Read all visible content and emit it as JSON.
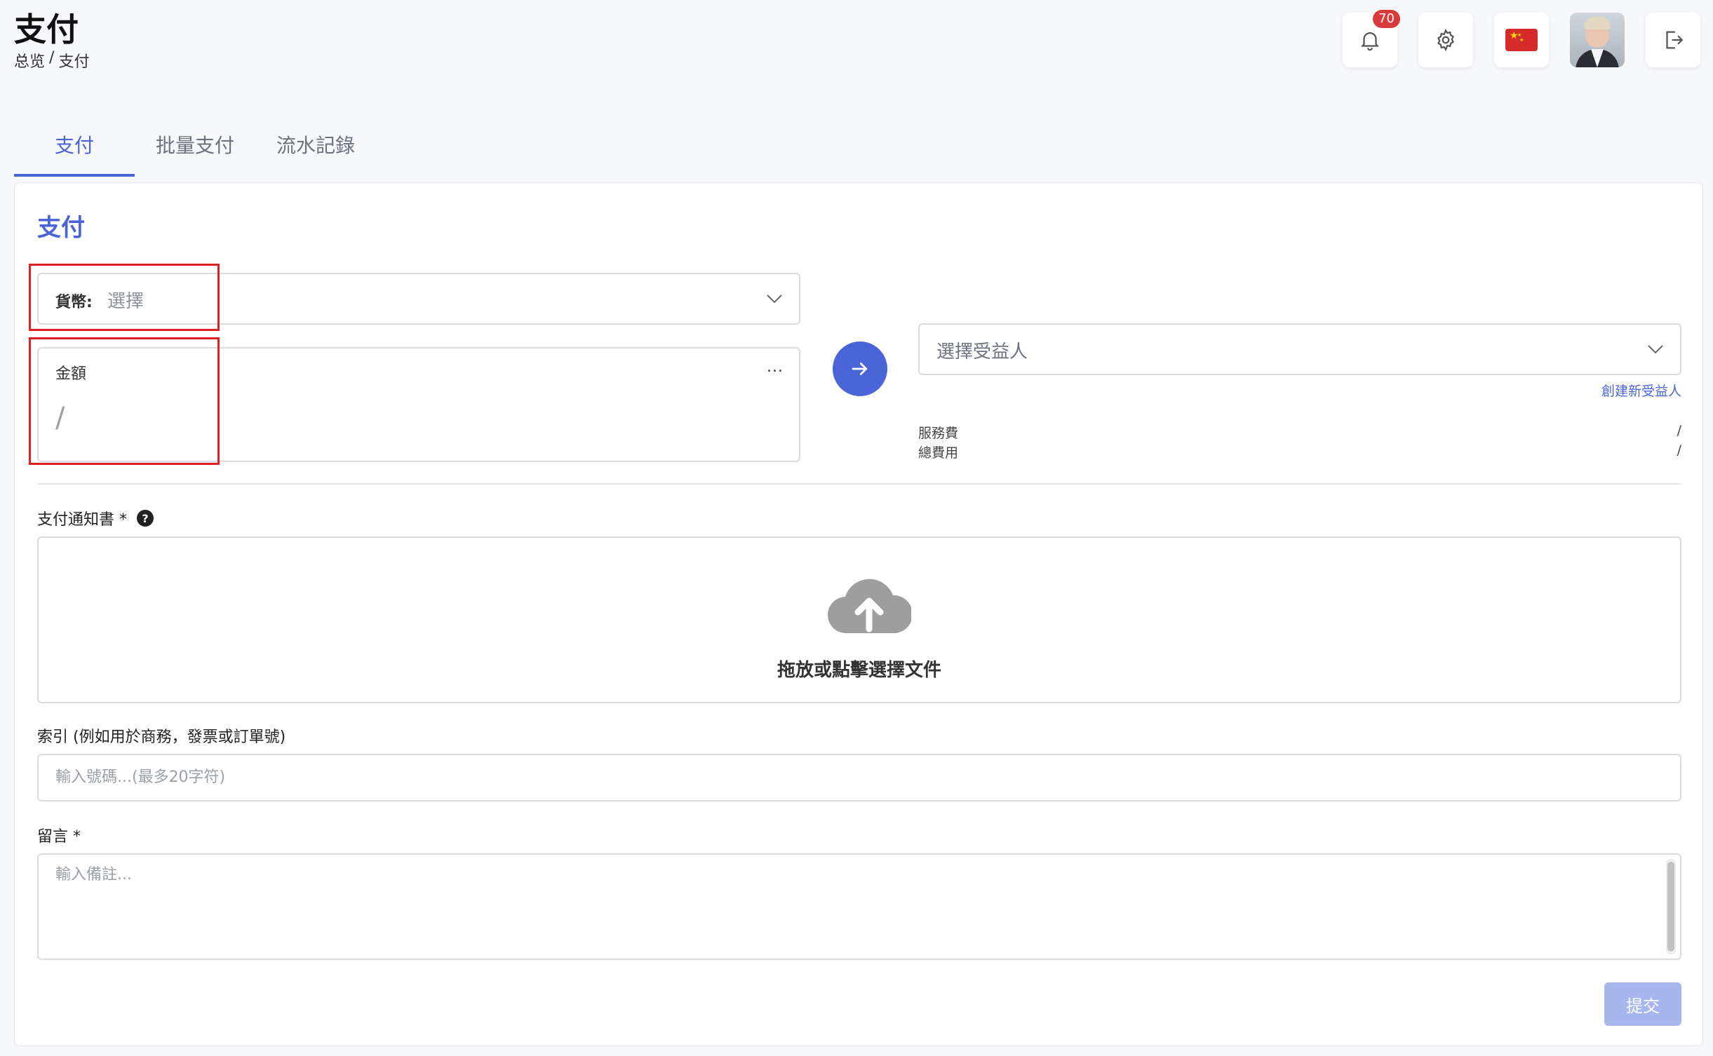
{
  "header": {
    "title": "支付",
    "breadcrumb": [
      "总览",
      "/",
      "支付"
    ],
    "notification_count": "70"
  },
  "tabs": [
    {
      "label": "支付",
      "active": true
    },
    {
      "label": "批量支付",
      "active": false
    },
    {
      "label": "流水記錄",
      "active": false
    }
  ],
  "form": {
    "title": "支付",
    "currency": {
      "label": "貨幣:",
      "value": "選擇"
    },
    "amount": {
      "label": "金額",
      "value": "/",
      "more": "..."
    },
    "beneficiary": {
      "placeholder": "選擇受益人",
      "create_link": "創建新受益人"
    },
    "fees": [
      {
        "label": "服務費",
        "value": "/"
      },
      {
        "label": "總費用",
        "value": "/"
      }
    ],
    "notice": {
      "label": "支付通知書 *",
      "help": "?",
      "upload_text": "拖放或點擊選擇文件"
    },
    "reference": {
      "label": "索引 (例如用於商務，發票或訂單號)",
      "placeholder": "輸入號碼...(最多20字符)"
    },
    "message": {
      "label": "留言 *",
      "placeholder": "輸入備註..."
    },
    "submit_label": "提交"
  },
  "colors": {
    "accent": "#4a64d8",
    "badge": "#d93a3a",
    "submit_disabled": "#a8b6ee"
  }
}
